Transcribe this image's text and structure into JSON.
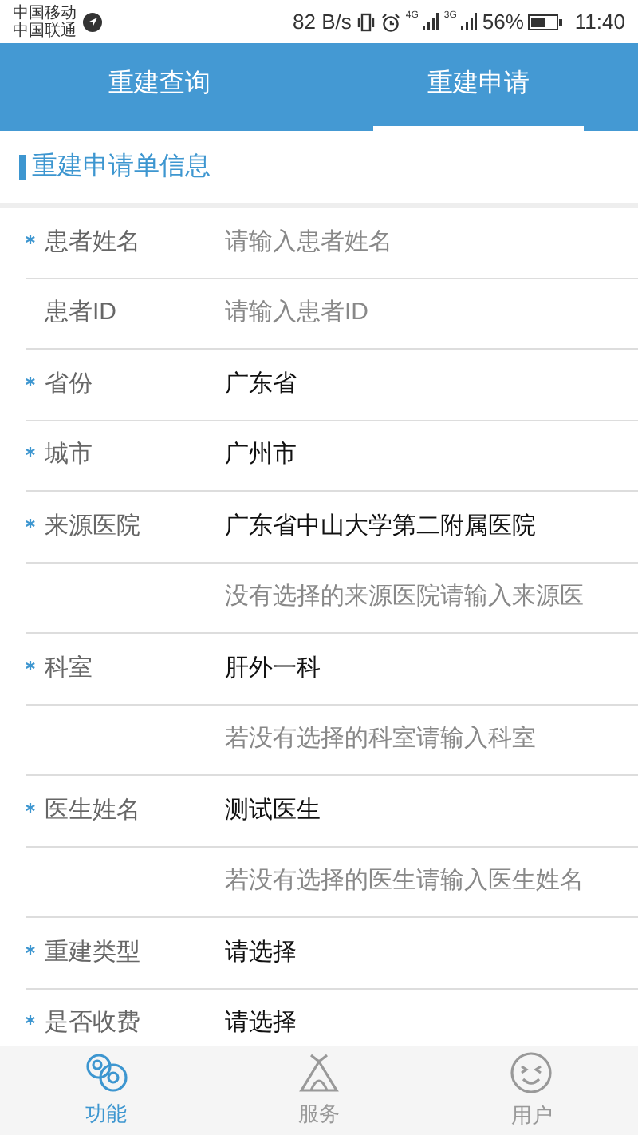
{
  "status_bar": {
    "carriers": [
      "中国移动",
      "中国联通"
    ],
    "speed": "82 B/s",
    "network_1": "4G",
    "network_2": "3G",
    "battery": "56%",
    "time": "11:40"
  },
  "tabs": [
    {
      "label": "重建查询",
      "selected": false
    },
    {
      "label": "重建申请",
      "selected": true
    }
  ],
  "section_title": "重建申请单信息",
  "form_rows": [
    {
      "label": "患者姓名",
      "required": true,
      "kind": "input",
      "placeholder": "请输入患者姓名"
    },
    {
      "label": "患者ID",
      "required": false,
      "kind": "input",
      "placeholder": "请输入患者ID"
    },
    {
      "label": "省份",
      "required": true,
      "kind": "select",
      "value": "广东省"
    },
    {
      "label": "城市",
      "required": true,
      "kind": "select",
      "value": "广州市"
    },
    {
      "label": "来源医院",
      "required": true,
      "kind": "select",
      "value": "广东省中山大学第二附属医院"
    },
    {
      "required": false,
      "kind": "input",
      "placeholder": "没有选择的来源医院请输入来源医"
    },
    {
      "label": "科室",
      "required": true,
      "kind": "select",
      "value": "肝外一科"
    },
    {
      "required": false,
      "kind": "input",
      "placeholder": "若没有选择的科室请输入科室"
    },
    {
      "label": "医生姓名",
      "required": true,
      "kind": "select",
      "value": "测试医生"
    },
    {
      "required": false,
      "kind": "input",
      "placeholder": "若没有选择的医生请输入医生姓名"
    },
    {
      "label": "重建类型",
      "required": true,
      "kind": "select",
      "value": "请选择"
    },
    {
      "label": "是否收费",
      "required": true,
      "kind": "select",
      "value": "请选择"
    }
  ],
  "bottom_nav": [
    {
      "label": "功能",
      "selected": true,
      "kind": "circles"
    },
    {
      "label": "服务",
      "selected": false,
      "kind": "tent"
    },
    {
      "label": "用户",
      "selected": false,
      "kind": "smiley"
    }
  ]
}
